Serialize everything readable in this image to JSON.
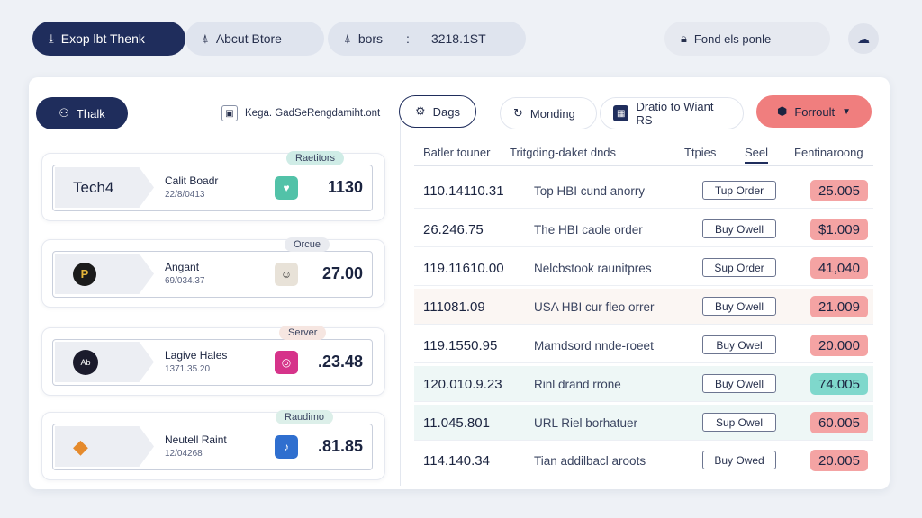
{
  "topbar": {
    "tab1": "Exop lbt Thenk",
    "tab2": "Abcut Btore",
    "tab3_label": "bors",
    "tab3_sep": ":",
    "tab3_value": "3218.1ST",
    "search_text": "Fond els ponle"
  },
  "toolbar": {
    "left_button": "Thalk",
    "breadcrumb": "Kega. GadSeRengdamiht.ont",
    "dags_button": "Dags",
    "monding_button": "Monding",
    "doratio_button": "Dratio to Wiant RS",
    "forroult_button": "Forroult"
  },
  "cards": [
    {
      "tag": "Raetitors",
      "name": "Calit Boadr",
      "sub": "22/8/0413",
      "price": "1130",
      "logo": "Tech4",
      "tag_color": "#cfece6",
      "app_color": "#52c2a8",
      "app_icon": "♥"
    },
    {
      "tag": "Orcue",
      "name": "Angant",
      "sub": "69/034.37",
      "price": "27.00",
      "logo": "P",
      "tag_color": "#e9ebf0",
      "app_color": "#e8e2d8",
      "app_icon": "☺"
    },
    {
      "tag": "Server",
      "name": "Lagive Hales",
      "sub": "1371.35.20",
      "price": ".23.48",
      "logo": "Ab",
      "tag_color": "#f6e6e1",
      "app_color": "#d6338a",
      "app_icon": "◎"
    },
    {
      "tag": "Raudimo",
      "name": "Neutell Raint",
      "sub": "12/04268",
      "price": ".81.85",
      "logo": "◆",
      "tag_color": "#dcefe9",
      "app_color": "#2f6fcf",
      "app_icon": "♪"
    }
  ],
  "table": {
    "headers": [
      "Batler touner",
      "Tritgding-daket dnds",
      "Ttpies",
      "Seel",
      "Fentinaroong"
    ],
    "rows": [
      {
        "id": "110.14110.31",
        "desc": "Top HBI cund anorry",
        "btn": "Tup Order",
        "amt": "25.005",
        "style": "row-a",
        "amt_style": "amt-red"
      },
      {
        "id": "26.246.75",
        "desc": "The HBI caole order",
        "btn": "Buy Owell",
        "amt": "$1.009",
        "style": "row-a",
        "amt_style": "amt-red"
      },
      {
        "id": "119.11610.00",
        "desc": "Nelcbstook raunitpres",
        "btn": "Sup Order",
        "amt": "41,040",
        "style": "row-a",
        "amt_style": "amt-red"
      },
      {
        "id": "111081.09",
        "desc": "USA HBI cur fleo orrer",
        "btn": "Buy Owell",
        "amt": "21.009",
        "style": "row-b",
        "amt_style": "amt-red"
      },
      {
        "id": "119.1550.95",
        "desc": "Mamdsord nnde-roeet",
        "btn": "Buy Owel",
        "amt": "20.000",
        "style": "row-a",
        "amt_style": "amt-red"
      },
      {
        "id": "120.010.9.23",
        "desc": "Rinl drand rrone",
        "btn": "Buy Owell",
        "amt": "74.005",
        "style": "row-c",
        "amt_style": "amt-green"
      },
      {
        "id": "11.045.801",
        "desc": "URL Riel borhatuer",
        "btn": "Sup Owel",
        "amt": "60.005",
        "style": "row-c",
        "amt_style": "amt-red"
      },
      {
        "id": "114.140.34",
        "desc": "Tian addilbacl aroots",
        "btn": "Buy Owed",
        "amt": "20.005",
        "style": "row-a",
        "amt_style": "amt-red"
      }
    ]
  }
}
